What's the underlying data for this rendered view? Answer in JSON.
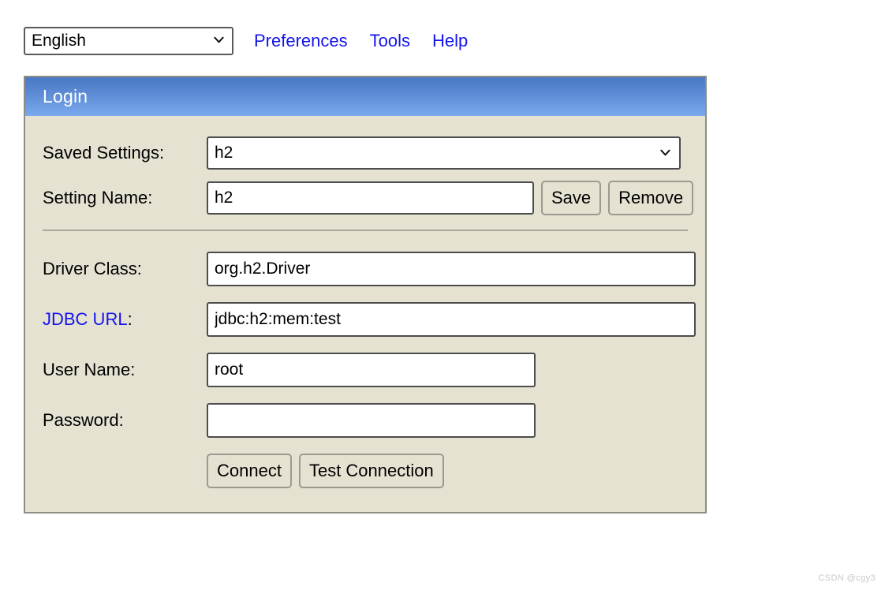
{
  "toolbar": {
    "language_selected": "English",
    "language_options": [
      "English"
    ],
    "language_chevron_icon": "chevron-down-icon",
    "links": [
      {
        "label": "Preferences"
      },
      {
        "label": "Tools"
      },
      {
        "label": "Help"
      }
    ]
  },
  "panel": {
    "title": "Login",
    "accent_color": "#5e8cd6",
    "background_color": "#e5e2d2",
    "link_color": "#1414ee",
    "fields": {
      "saved_settings": {
        "label": "Saved Settings:",
        "value": "h2",
        "chevron_icon": "chevron-down-icon"
      },
      "setting_name": {
        "label": "Setting Name:",
        "value": "h2",
        "placeholder": ""
      },
      "driver_class": {
        "label": "Driver Class:",
        "value": "org.h2.Driver",
        "placeholder": ""
      },
      "jdbc_url": {
        "label": "JDBC URL",
        "label_suffix": ":",
        "value": "jdbc:h2:mem:test",
        "placeholder": ""
      },
      "user_name": {
        "label": "User Name:",
        "value": "root",
        "placeholder": ""
      },
      "password": {
        "label": "Password:",
        "value": "",
        "placeholder": ""
      }
    },
    "buttons": {
      "save": "Save",
      "remove": "Remove",
      "connect": "Connect",
      "test_connection": "Test Connection"
    }
  },
  "watermark": {
    "text": "CSDN @cgy3"
  }
}
